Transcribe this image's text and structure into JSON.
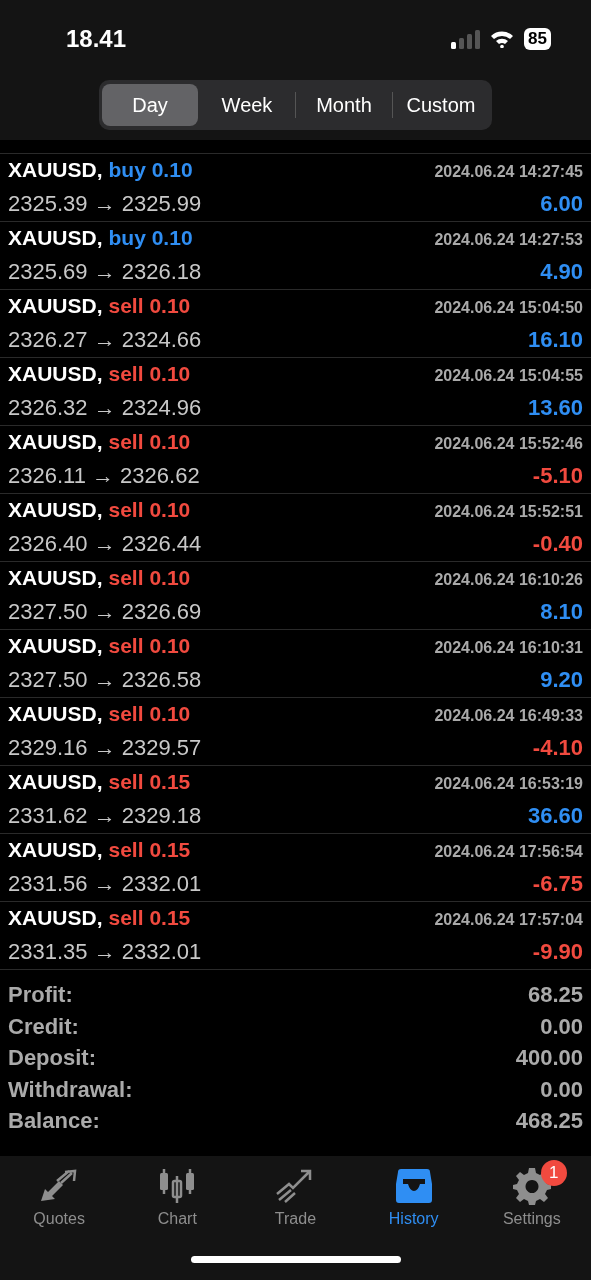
{
  "status_bar": {
    "time": "18.41",
    "battery": "85"
  },
  "tabs": [
    {
      "label": "Day",
      "selected": true
    },
    {
      "label": "Week",
      "selected": false
    },
    {
      "label": "Month",
      "selected": false
    },
    {
      "label": "Custom",
      "selected": false
    }
  ],
  "trades": [
    {
      "symbol": "XAUUSD,",
      "order": "buy 0.10",
      "sell": false,
      "time": "2024.06.24 14:27:45",
      "prices": "2325.39 → 2325.99",
      "profit": "6.00",
      "loss": false
    },
    {
      "symbol": "XAUUSD,",
      "order": "buy 0.10",
      "sell": false,
      "time": "2024.06.24 14:27:53",
      "prices": "2325.69 → 2326.18",
      "profit": "4.90",
      "loss": false
    },
    {
      "symbol": "XAUUSD,",
      "order": "sell 0.10",
      "sell": true,
      "time": "2024.06.24 15:04:50",
      "prices": "2326.27 → 2324.66",
      "profit": "16.10",
      "loss": false
    },
    {
      "symbol": "XAUUSD,",
      "order": "sell 0.10",
      "sell": true,
      "time": "2024.06.24 15:04:55",
      "prices": "2326.32 → 2324.96",
      "profit": "13.60",
      "loss": false
    },
    {
      "symbol": "XAUUSD,",
      "order": "sell 0.10",
      "sell": true,
      "time": "2024.06.24 15:52:46",
      "prices": "2326.11 → 2326.62",
      "profit": "-5.10",
      "loss": true
    },
    {
      "symbol": "XAUUSD,",
      "order": "sell 0.10",
      "sell": true,
      "time": "2024.06.24 15:52:51",
      "prices": "2326.40 → 2326.44",
      "profit": "-0.40",
      "loss": true
    },
    {
      "symbol": "XAUUSD,",
      "order": "sell 0.10",
      "sell": true,
      "time": "2024.06.24 16:10:26",
      "prices": "2327.50 → 2326.69",
      "profit": "8.10",
      "loss": false
    },
    {
      "symbol": "XAUUSD,",
      "order": "sell 0.10",
      "sell": true,
      "time": "2024.06.24 16:10:31",
      "prices": "2327.50 → 2326.58",
      "profit": "9.20",
      "loss": false
    },
    {
      "symbol": "XAUUSD,",
      "order": "sell 0.10",
      "sell": true,
      "time": "2024.06.24 16:49:33",
      "prices": "2329.16 → 2329.57",
      "profit": "-4.10",
      "loss": true
    },
    {
      "symbol": "XAUUSD,",
      "order": "sell 0.15",
      "sell": true,
      "time": "2024.06.24 16:53:19",
      "prices": "2331.62 → 2329.18",
      "profit": "36.60",
      "loss": false
    },
    {
      "symbol": "XAUUSD,",
      "order": "sell 0.15",
      "sell": true,
      "time": "2024.06.24 17:56:54",
      "prices": "2331.56 → 2332.01",
      "profit": "-6.75",
      "loss": true
    },
    {
      "symbol": "XAUUSD,",
      "order": "sell 0.15",
      "sell": true,
      "time": "2024.06.24 17:57:04",
      "prices": "2331.35 → 2332.01",
      "profit": "-9.90",
      "loss": true
    }
  ],
  "summary": [
    {
      "label": "Profit:",
      "value": "68.25"
    },
    {
      "label": "Credit:",
      "value": "0.00"
    },
    {
      "label": "Deposit:",
      "value": "400.00"
    },
    {
      "label": "Withdrawal:",
      "value": "0.00"
    },
    {
      "label": "Balance:",
      "value": "468.25"
    }
  ],
  "nav": [
    {
      "label": "Quotes",
      "kind": "quotes",
      "selected": false
    },
    {
      "label": "Chart",
      "kind": "chart",
      "selected": false
    },
    {
      "label": "Trade",
      "kind": "trade",
      "selected": false
    },
    {
      "label": "History",
      "kind": "history",
      "selected": true
    },
    {
      "label": "Settings",
      "kind": "settings",
      "selected": false,
      "badge": "1"
    }
  ]
}
